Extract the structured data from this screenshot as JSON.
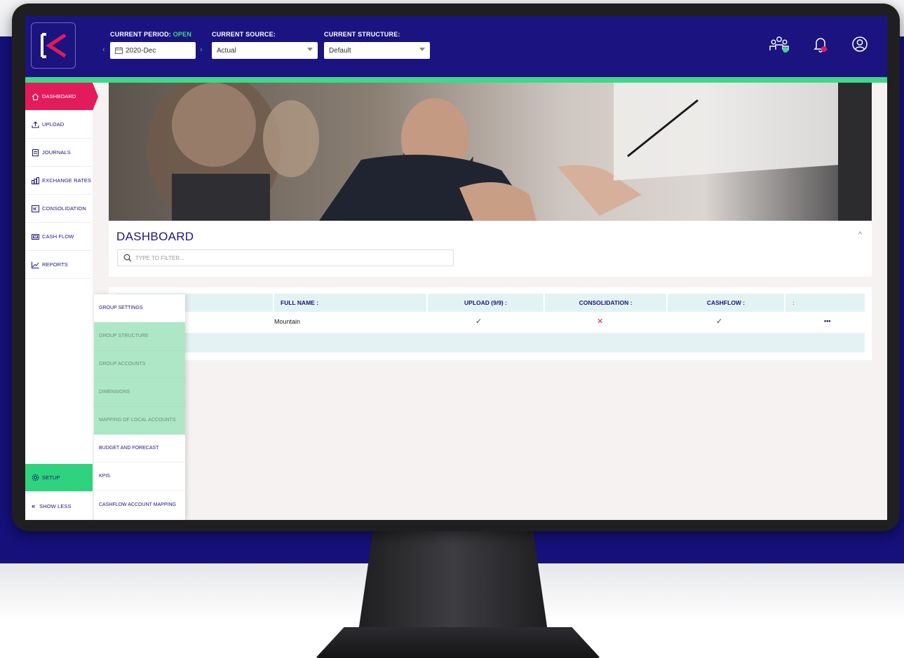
{
  "header": {
    "period_label": "CURRENT PERIOD:",
    "period_status": "OPEN",
    "period_value": "2020-Dec",
    "source_label": "CURRENT SOURCE:",
    "source_value": "Actual",
    "structure_label": "CURRENT STRUCTURE:",
    "structure_value": "Default",
    "prev_arrow": "‹",
    "next_arrow": "›"
  },
  "sidebar": {
    "items": [
      {
        "label": "DASHBOARD",
        "icon": "home-icon"
      },
      {
        "label": "UPLOAD",
        "icon": "upload-icon"
      },
      {
        "label": "JOURNALS",
        "icon": "journal-icon"
      },
      {
        "label": "EXCHANGE RATES",
        "icon": "exchange-icon"
      },
      {
        "label": "CONSOLIDATION",
        "icon": "consolidation-icon"
      },
      {
        "label": "CASH FLOW",
        "icon": "cash-icon"
      },
      {
        "label": "REPORTS",
        "icon": "chart-line-icon"
      }
    ],
    "setup_label": "SETUP",
    "show_less_label": "SHOW LESS"
  },
  "submenu": {
    "items": [
      "GROUP SETTINGS",
      "GROUP STRUCTURE",
      "GROUP ACCOUNTS",
      "DIMENSIONS",
      "MAPPING OF LOCAL ACCOUNTS",
      "BUDGET AND FORECAST",
      "KPIS",
      "CASHFLOW ACCOUNT MAPPING"
    ]
  },
  "dashboard": {
    "title": "DASHBOARD",
    "filter_placeholder": "TYPE TO FILTER...",
    "table": {
      "columns": [
        "FULL NAME :",
        "UPLOAD (9/9) :",
        "CONSOLIDATION :",
        "CASHFLOW :",
        ":"
      ],
      "rows": [
        {
          "full_name": "Mountain",
          "upload": "✓",
          "consolidation": "✕",
          "cashflow": "✓",
          "actions": "•••"
        }
      ]
    }
  },
  "colors": {
    "navy": "#1b1480",
    "accent_green": "#3fd88a",
    "active_red": "#e21b5a",
    "highlight_green": "#aee7c6",
    "table_header": "#e3f3f3"
  }
}
